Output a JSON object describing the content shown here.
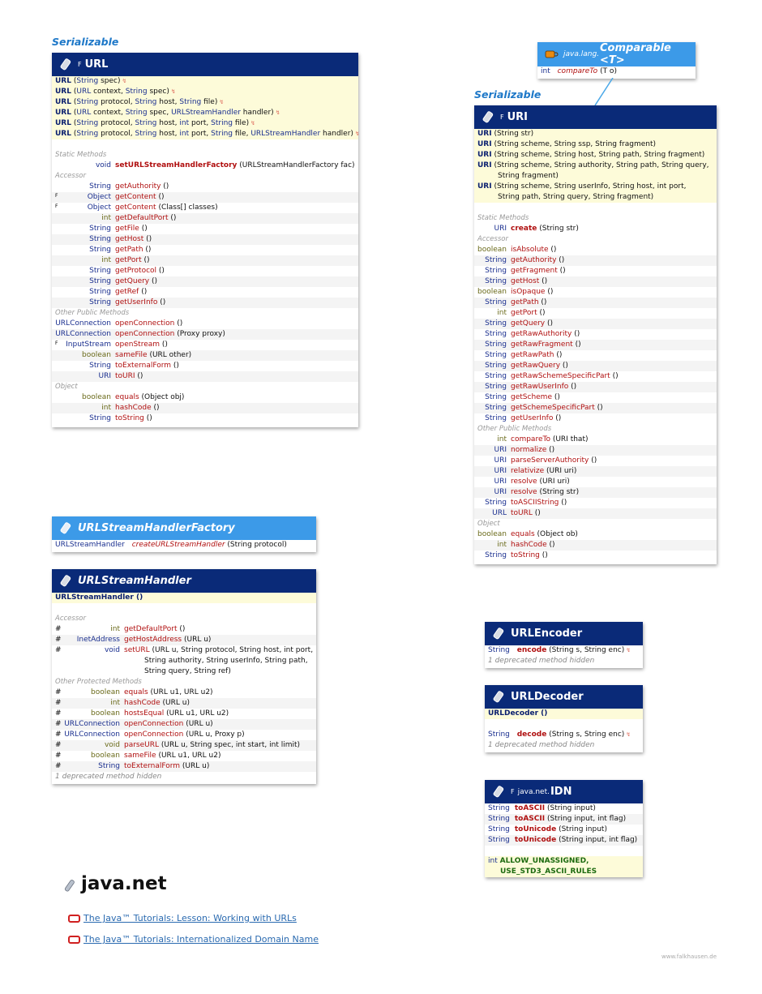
{
  "url_box": {
    "serializable": "Serializable",
    "fin": "F",
    "title": "URL",
    "ctors": [
      [
        "URL",
        " (",
        "String",
        " spec)"
      ],
      [
        "URL",
        " (",
        "URL",
        " context, ",
        "String",
        " spec)"
      ],
      [
        "URL",
        " (",
        "String",
        " protocol, ",
        "String",
        " host, ",
        "String",
        " file)"
      ],
      [
        "URL",
        " (",
        "URL",
        " context, ",
        "String",
        " spec, ",
        "URLStreamHandler",
        " handler)"
      ],
      [
        "URL",
        " (",
        "String",
        " protocol, ",
        "String",
        " host, ",
        "int",
        " port, ",
        "String",
        " file)"
      ],
      [
        "URL",
        " (",
        "String",
        " protocol, ",
        "String",
        " host, ",
        "int",
        " port, ",
        "String",
        " file, ",
        "URLStreamHandler",
        " handler)"
      ]
    ],
    "sec_static": "Static Methods",
    "static_ret": "void",
    "static_name": "setURLStreamHandlerFactory",
    "static_args": " (URLStreamHandlerFactory fac)",
    "sec_accessor": "Accessor",
    "accessors": [
      {
        "mod": "",
        "ret": "String",
        "name": "getAuthority",
        "args": " ()"
      },
      {
        "mod": "F",
        "ret": "Object",
        "name": "getContent",
        "args": " ()"
      },
      {
        "mod": "F",
        "ret": "Object",
        "name": "getContent",
        "args": " (Class[] classes)"
      },
      {
        "mod": "",
        "ret": "int",
        "name": "getDefaultPort",
        "args": " ()"
      },
      {
        "mod": "",
        "ret": "String",
        "name": "getFile",
        "args": " ()"
      },
      {
        "mod": "",
        "ret": "String",
        "name": "getHost",
        "args": " ()"
      },
      {
        "mod": "",
        "ret": "String",
        "name": "getPath",
        "args": " ()"
      },
      {
        "mod": "",
        "ret": "int",
        "name": "getPort",
        "args": " ()"
      },
      {
        "mod": "",
        "ret": "String",
        "name": "getProtocol",
        "args": " ()"
      },
      {
        "mod": "",
        "ret": "String",
        "name": "getQuery",
        "args": " ()"
      },
      {
        "mod": "",
        "ret": "String",
        "name": "getRef",
        "args": " ()"
      },
      {
        "mod": "",
        "ret": "String",
        "name": "getUserInfo",
        "args": " ()"
      }
    ],
    "sec_other": "Other Public Methods",
    "others": [
      {
        "mod": "",
        "ret": "URLConnection",
        "name": "openConnection",
        "args": " ()"
      },
      {
        "mod": "",
        "ret": "URLConnection",
        "name": "openConnection",
        "args": " (Proxy proxy)"
      },
      {
        "mod": "F",
        "ret": "InputStream",
        "name": "openStream",
        "args": " ()"
      },
      {
        "mod": "",
        "ret": "boolean",
        "name": "sameFile",
        "args": " (URL other)"
      },
      {
        "mod": "",
        "ret": "String",
        "name": "toExternalForm",
        "args": " ()"
      },
      {
        "mod": "",
        "ret": "URI",
        "name": "toURI",
        "args": " ()"
      }
    ],
    "sec_object": "Object",
    "objects": [
      {
        "ret": "boolean",
        "name": "equals",
        "args": " (Object obj)"
      },
      {
        "ret": "int",
        "name": "hashCode",
        "args": " ()"
      },
      {
        "ret": "String",
        "name": "toString",
        "args": " ()"
      }
    ]
  },
  "comparable_box": {
    "pkg": "java.lang.",
    "title": "Comparable <T>",
    "ret": "int",
    "name": "compareTo",
    "args": " (T o)"
  },
  "uri_box": {
    "serializable": "Serializable",
    "fin": "F",
    "title": "URI",
    "ctors": [
      "URI (String str)",
      "URI (String scheme, String ssp, String fragment)",
      "URI (String scheme, String host, String path, String fragment)",
      "URI (String scheme, String authority, String path, String query,",
      "String fragment)",
      "URI (String scheme, String userInfo, String host, int port,",
      "String path, String query, String fragment)"
    ],
    "sec_static": "Static Methods",
    "static_ret": "URI",
    "static_name": "create",
    "static_args": " (String str)",
    "sec_accessor": "Accessor",
    "accessors": [
      {
        "ret": "boolean",
        "name": "isAbsolute",
        "args": " ()"
      },
      {
        "ret": "String",
        "name": "getAuthority",
        "args": " ()"
      },
      {
        "ret": "String",
        "name": "getFragment",
        "args": " ()"
      },
      {
        "ret": "String",
        "name": "getHost",
        "args": " ()"
      },
      {
        "ret": "boolean",
        "name": "isOpaque",
        "args": " ()"
      },
      {
        "ret": "String",
        "name": "getPath",
        "args": " ()"
      },
      {
        "ret": "int",
        "name": "getPort",
        "args": " ()"
      },
      {
        "ret": "String",
        "name": "getQuery",
        "args": " ()"
      },
      {
        "ret": "String",
        "name": "getRawAuthority",
        "args": " ()"
      },
      {
        "ret": "String",
        "name": "getRawFragment",
        "args": " ()"
      },
      {
        "ret": "String",
        "name": "getRawPath",
        "args": " ()"
      },
      {
        "ret": "String",
        "name": "getRawQuery",
        "args": " ()"
      },
      {
        "ret": "String",
        "name": "getRawSchemeSpecificPart",
        "args": " ()"
      },
      {
        "ret": "String",
        "name": "getRawUserInfo",
        "args": " ()"
      },
      {
        "ret": "String",
        "name": "getScheme",
        "args": " ()"
      },
      {
        "ret": "String",
        "name": "getSchemeSpecificPart",
        "args": " ()"
      },
      {
        "ret": "String",
        "name": "getUserInfo",
        "args": " ()"
      }
    ],
    "sec_other": "Other Public Methods",
    "others": [
      {
        "ret": "int",
        "name": "compareTo",
        "args": " (URI that)"
      },
      {
        "ret": "URI",
        "name": "normalize",
        "args": " ()"
      },
      {
        "ret": "URI",
        "name": "parseServerAuthority",
        "args": " ()"
      },
      {
        "ret": "URI",
        "name": "relativize",
        "args": " (URI uri)"
      },
      {
        "ret": "URI",
        "name": "resolve",
        "args": " (URI uri)"
      },
      {
        "ret": "URI",
        "name": "resolve",
        "args": " (String str)"
      },
      {
        "ret": "String",
        "name": "toASCIIString",
        "args": " ()"
      },
      {
        "ret": "URL",
        "name": "toURL",
        "args": " ()"
      }
    ],
    "sec_object": "Object",
    "objects": [
      {
        "ret": "boolean",
        "name": "equals",
        "args": " (Object ob)"
      },
      {
        "ret": "int",
        "name": "hashCode",
        "args": " ()"
      },
      {
        "ret": "String",
        "name": "toString",
        "args": " ()"
      }
    ]
  },
  "factory_box": {
    "title": "URLStreamHandlerFactory",
    "ret": "URLStreamHandler",
    "name": "createURLStreamHandler",
    "args": " (String protocol)"
  },
  "handler_box": {
    "title": "URLStreamHandler",
    "ctor": "URLStreamHandler ()",
    "sec_accessor": "Accessor",
    "accessors": [
      {
        "mod": "#",
        "ret": "int",
        "name": "getDefaultPort",
        "args": " ()"
      },
      {
        "mod": "#",
        "ret": "InetAddress",
        "name": "getHostAddress",
        "args": " (URL u)"
      }
    ],
    "seturl_mod": "#",
    "seturl_ret": "void",
    "seturl_name": "setURL",
    "seturl_args1": " (URL u, String protocol, String host, int port,",
    "seturl_args2": "String authority, String userInfo, String path,",
    "seturl_args3": "String query, String ref)",
    "sec_other": "Other Protected Methods",
    "others": [
      {
        "mod": "#",
        "ret": "boolean",
        "name": "equals",
        "args": " (URL u1, URL u2)"
      },
      {
        "mod": "#",
        "ret": "int",
        "name": "hashCode",
        "args": " (URL u)"
      },
      {
        "mod": "#",
        "ret": "boolean",
        "name": "hostsEqual",
        "args": " (URL u1, URL u2)"
      },
      {
        "mod": "#",
        "ret": "URLConnection",
        "name": "openConnection",
        "args": " (URL u)"
      },
      {
        "mod": "#",
        "ret": "URLConnection",
        "name": "openConnection",
        "args": " (URL u, Proxy p)"
      },
      {
        "mod": "#",
        "ret": "void",
        "name": "parseURL",
        "args": " (URL u, String spec, int start, int limit)"
      },
      {
        "mod": "#",
        "ret": "boolean",
        "name": "sameFile",
        "args": " (URL u1, URL u2)"
      },
      {
        "mod": "#",
        "ret": "String",
        "name": "toExternalForm",
        "args": " (URL u)"
      }
    ],
    "footer": "1 deprecated method hidden"
  },
  "encoder_box": {
    "title": "URLEncoder",
    "ret": "String",
    "name": "encode",
    "args": " (String s, String enc)",
    "footer": "1 deprecated method hidden"
  },
  "decoder_box": {
    "title": "URLDecoder",
    "ctor": "URLDecoder ()",
    "ret": "String",
    "name": "decode",
    "args": " (String s, String enc)",
    "footer": "1 deprecated method hidden"
  },
  "idn_box": {
    "fin": "F",
    "pkg": "java.net.",
    "title": "IDN",
    "methods": [
      {
        "ret": "String",
        "name": "toASCII",
        "args": " (String input)"
      },
      {
        "ret": "String",
        "name": "toASCII",
        "args": " (String input, int flag)"
      },
      {
        "ret": "String",
        "name": "toUnicode",
        "args": " (String input)"
      },
      {
        "ret": "String",
        "name": "toUnicode",
        "args": " (String input, int flag)"
      }
    ],
    "field_type": "int",
    "field1": "ALLOW_UNASSIGNED,",
    "field2": "USE_STD3_ASCII_RULES"
  },
  "package_title": "java.net",
  "links": [
    "The Java™ Tutorials: Lesson: Working with URLs",
    "The Java™ Tutorials: Internationalized Domain Name"
  ],
  "watermark": "www.falkhausen.de"
}
